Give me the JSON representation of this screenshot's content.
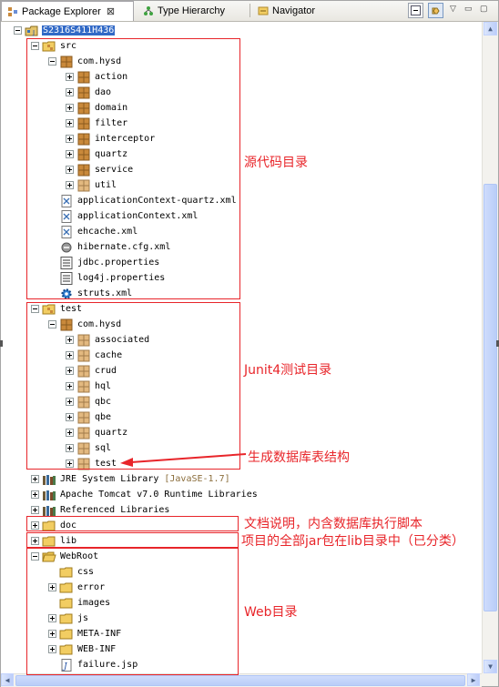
{
  "tabs": [
    {
      "label": "Package Explorer",
      "icon": "package-explorer-icon",
      "active": true,
      "close": "⊠"
    },
    {
      "label": "Type Hierarchy",
      "icon": "type-hierarchy-icon",
      "active": false
    },
    {
      "label": "Navigator",
      "icon": "navigator-icon",
      "active": false
    }
  ],
  "toolbar": {
    "collapse_all": "collapse-all-icon",
    "link_editor": "link-with-editor-icon",
    "view_menu": "▽",
    "minimize": "▭",
    "maximize": "▢"
  },
  "tree": [
    {
      "label": "S2316S411H436",
      "depth": 0,
      "toggle": "minus",
      "icon": "project",
      "selected": true
    },
    {
      "label": "src",
      "depth": 1,
      "toggle": "minus",
      "icon": "source-folder"
    },
    {
      "label": "com.hysd",
      "depth": 2,
      "toggle": "minus",
      "icon": "package"
    },
    {
      "label": "action",
      "depth": 3,
      "toggle": "plus",
      "icon": "package"
    },
    {
      "label": "dao",
      "depth": 3,
      "toggle": "plus",
      "icon": "package"
    },
    {
      "label": "domain",
      "depth": 3,
      "toggle": "plus",
      "icon": "package"
    },
    {
      "label": "filter",
      "depth": 3,
      "toggle": "plus",
      "icon": "package"
    },
    {
      "label": "interceptor",
      "depth": 3,
      "toggle": "plus",
      "icon": "package"
    },
    {
      "label": "quartz",
      "depth": 3,
      "toggle": "plus",
      "icon": "package"
    },
    {
      "label": "service",
      "depth": 3,
      "toggle": "plus",
      "icon": "package"
    },
    {
      "label": "util",
      "depth": 3,
      "toggle": "plus",
      "icon": "package-faded"
    },
    {
      "label": "applicationContext-quartz.xml",
      "depth": 2,
      "toggle": "none",
      "icon": "xml-file"
    },
    {
      "label": "applicationContext.xml",
      "depth": 2,
      "toggle": "none",
      "icon": "xml-file"
    },
    {
      "label": "ehcache.xml",
      "depth": 2,
      "toggle": "none",
      "icon": "xml-file"
    },
    {
      "label": "hibernate.cfg.xml",
      "depth": 2,
      "toggle": "none",
      "icon": "hibernate-file"
    },
    {
      "label": "jdbc.properties",
      "depth": 2,
      "toggle": "none",
      "icon": "properties-file"
    },
    {
      "label": "log4j.properties",
      "depth": 2,
      "toggle": "none",
      "icon": "properties-file"
    },
    {
      "label": "struts.xml",
      "depth": 2,
      "toggle": "none",
      "icon": "struts-gear"
    },
    {
      "label": "test",
      "depth": 1,
      "toggle": "minus",
      "icon": "source-folder"
    },
    {
      "label": "com.hysd",
      "depth": 2,
      "toggle": "minus",
      "icon": "package"
    },
    {
      "label": "associated",
      "depth": 3,
      "toggle": "plus",
      "icon": "package-faded"
    },
    {
      "label": "cache",
      "depth": 3,
      "toggle": "plus",
      "icon": "package-faded"
    },
    {
      "label": "crud",
      "depth": 3,
      "toggle": "plus",
      "icon": "package-faded"
    },
    {
      "label": "hql",
      "depth": 3,
      "toggle": "plus",
      "icon": "package-faded"
    },
    {
      "label": "qbc",
      "depth": 3,
      "toggle": "plus",
      "icon": "package-faded"
    },
    {
      "label": "qbe",
      "depth": 3,
      "toggle": "plus",
      "icon": "package-faded"
    },
    {
      "label": "quartz",
      "depth": 3,
      "toggle": "plus",
      "icon": "package-faded"
    },
    {
      "label": "sql",
      "depth": 3,
      "toggle": "plus",
      "icon": "package-faded"
    },
    {
      "label": "test",
      "depth": 3,
      "toggle": "plus",
      "icon": "package-faded"
    },
    {
      "label": "JRE System Library",
      "decoration": "[JavaSE-1.7]",
      "depth": 1,
      "toggle": "plus",
      "icon": "library"
    },
    {
      "label": "Apache Tomcat v7.0 Runtime Libraries",
      "depth": 1,
      "toggle": "plus",
      "icon": "library"
    },
    {
      "label": "Referenced Libraries",
      "depth": 1,
      "toggle": "plus",
      "icon": "library"
    },
    {
      "label": "doc",
      "depth": 1,
      "toggle": "plus",
      "icon": "folder"
    },
    {
      "label": "lib",
      "depth": 1,
      "toggle": "plus",
      "icon": "folder"
    },
    {
      "label": "WebRoot",
      "depth": 1,
      "toggle": "minus",
      "icon": "folder-open"
    },
    {
      "label": "css",
      "depth": 2,
      "toggle": "none",
      "icon": "folder"
    },
    {
      "label": "error",
      "depth": 2,
      "toggle": "plus",
      "icon": "folder"
    },
    {
      "label": "images",
      "depth": 2,
      "toggle": "none",
      "icon": "folder"
    },
    {
      "label": "js",
      "depth": 2,
      "toggle": "plus",
      "icon": "folder"
    },
    {
      "label": "META-INF",
      "depth": 2,
      "toggle": "plus",
      "icon": "folder"
    },
    {
      "label": "WEB-INF",
      "depth": 2,
      "toggle": "plus",
      "icon": "folder"
    },
    {
      "label": "failure.jsp",
      "depth": 2,
      "toggle": "none",
      "icon": "jsp-file"
    }
  ],
  "annotations": {
    "src_dir": "源代码目录",
    "test_dir": "Junit4测试目录",
    "schema": "生成数据库表结构",
    "doc_dir": "文档说明，内含数据库执行脚本",
    "lib_dir": "项目的全部jar包在lib目录中（已分类）",
    "web_dir": "Web目录"
  },
  "colors": {
    "annotation": "#e8252a",
    "selection": "#3169c6",
    "package": "#c9893b",
    "folder": "#f2cd62"
  }
}
